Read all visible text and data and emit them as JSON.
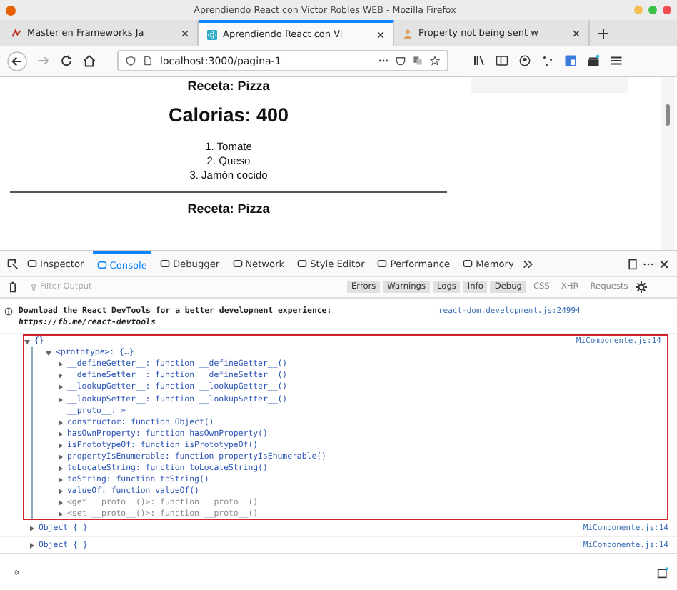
{
  "window": {
    "title": "Aprendiendo React con Victor Robles WEB - Mozilla Firefox"
  },
  "tabs": [
    {
      "label": "Master en Frameworks Ja",
      "selected": false,
      "kind": "logo"
    },
    {
      "label": "Aprendiendo React con Vi",
      "selected": true,
      "kind": "react"
    },
    {
      "label": "Property not being sent w",
      "selected": false,
      "kind": "figure"
    }
  ],
  "address": "localhost:3000/pagina-1",
  "page": {
    "heading": "Receta: Pizza",
    "calories": "Calorias: 400",
    "ingredients": [
      "1. Tomate",
      "2. Queso",
      "3. Jamón cocido"
    ],
    "next_heading": "Receta: Pizza"
  },
  "devtools": {
    "tools": [
      {
        "label": "Inspector",
        "selected": false
      },
      {
        "label": "Console",
        "selected": true
      },
      {
        "label": "Debugger",
        "selected": false
      },
      {
        "label": "Network",
        "selected": false
      },
      {
        "label": "Style Editor",
        "selected": false
      },
      {
        "label": "Performance",
        "selected": false
      },
      {
        "label": "Memory",
        "selected": false
      }
    ],
    "filter_placeholder": "Filter Output",
    "filters": [
      {
        "label": "Errors",
        "selected": true
      },
      {
        "label": "Warnings",
        "selected": true
      },
      {
        "label": "Logs",
        "selected": true
      },
      {
        "label": "Info",
        "selected": true
      },
      {
        "label": "Debug",
        "selected": true
      },
      {
        "label": "CSS",
        "selected": false
      },
      {
        "label": "XHR",
        "selected": false
      },
      {
        "label": "Requests",
        "selected": false
      }
    ],
    "message": {
      "text": "Download the React DevTools for a better development experience: *https://fb.me/react-devtools*",
      "source": "react-dom.development.js:24994"
    },
    "logged": {
      "label": "{}",
      "source": "MiComponente.js:14",
      "expanded": true,
      "children": [
        {
          "text": "<prototype>: {…}",
          "expanded": true,
          "kind": "node",
          "children": [
            {
              "text": "__defineGetter__: function __defineGetter__()",
              "expanded": false,
              "kind": "node"
            },
            {
              "text": "__defineSetter__: function __defineSetter__()",
              "expanded": false,
              "kind": "node"
            },
            {
              "text": "__lookupGetter__: function __lookupGetter__()",
              "expanded": false,
              "kind": "node"
            },
            {
              "text": "__lookupSetter__: function __lookupSetter__()",
              "expanded": false,
              "kind": "node"
            },
            {
              "text": "__proto__: »",
              "kind": "leaf"
            },
            {
              "text": "constructor: function Object()",
              "expanded": false,
              "kind": "node"
            },
            {
              "text": "hasOwnProperty: function hasOwnProperty()",
              "expanded": false,
              "kind": "node"
            },
            {
              "text": "isPrototypeOf: function isPrototypeOf()",
              "expanded": false,
              "kind": "node"
            },
            {
              "text": "propertyIsEnumerable: function propertyIsEnumerable()",
              "expanded": false,
              "kind": "node"
            },
            {
              "text": "toLocaleString: function toLocaleString()",
              "expanded": false,
              "kind": "node"
            },
            {
              "text": "toString: function toString()",
              "expanded": false,
              "kind": "node"
            },
            {
              "text": "valueOf: function valueOf()",
              "expanded": false,
              "kind": "node"
            },
            {
              "text": "<get __proto__()>: function __proto__()",
              "expanded": false,
              "kind": "accessor"
            },
            {
              "text": "<set __proto__()>: function __proto__()",
              "expanded": false,
              "kind": "accessor"
            }
          ]
        }
      ]
    },
    "collapsed": [
      {
        "label": "Object {  }",
        "source": "MiComponente.js:14",
        "expanded": false
      },
      {
        "label": "Object {  }",
        "source": "MiComponente.js:14",
        "expanded": false
      }
    ],
    "prompt": "»"
  }
}
